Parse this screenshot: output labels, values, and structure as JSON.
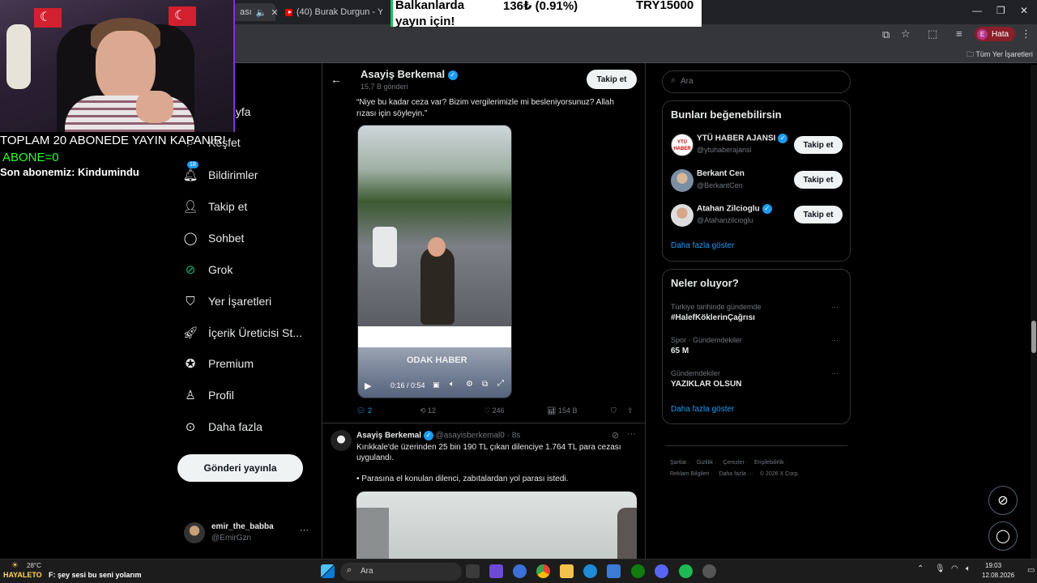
{
  "browser": {
    "tabs": [
      {
        "label": "ası",
        "active": true
      },
      {
        "label": "(40) Burak Durgun - YouTube",
        "active": false
      }
    ],
    "profile": {
      "initial": "E",
      "label": "Hata"
    },
    "bookmarks_folder": "Tüm Yer İşaretleri"
  },
  "ticker": {
    "line1": "Balkanlarda",
    "line2": "yayın için!",
    "change": "136₺ (0.91%)",
    "total": "TRY15000"
  },
  "stream_overlay": {
    "line1": "TOPLAM 20 ABONEDE YAYIN KAPANIR!",
    "line2": "ABONE=0",
    "line3": "Son abonemiz: Kindumindu"
  },
  "sidebar": {
    "items": [
      {
        "label": "ayfa",
        "icon": "home-icon"
      },
      {
        "label": "Keşfet",
        "icon": "search-icon"
      },
      {
        "label": "Bildirimler",
        "icon": "bell-icon",
        "badge": "18"
      },
      {
        "label": "Takip et",
        "icon": "add-user-icon"
      },
      {
        "label": "Sohbet",
        "icon": "chat-icon"
      },
      {
        "label": "Grok",
        "icon": "grok-icon"
      },
      {
        "label": "Yer İşaretleri",
        "icon": "bookmark-icon"
      },
      {
        "label": "İçerik Üreticisi St...",
        "icon": "rocket-icon"
      },
      {
        "label": "Premium",
        "icon": "verified-icon"
      },
      {
        "label": "Profil",
        "icon": "person-icon"
      },
      {
        "label": "Daha fazla",
        "icon": "more-circle-icon"
      }
    ],
    "post_button": "Gönderi yayınla",
    "account": {
      "name": "emir_the_babba",
      "handle": "@EmirGzn",
      "more": "···"
    }
  },
  "profile_header": {
    "name": "Asayiş Berkemal",
    "posts": "15,7 B gönderi",
    "follow": "Takip et"
  },
  "post1": {
    "text": "“Niye bu kadar ceza var? Bizim vergilerimizle mi besleniyorsunuz? Allah rızası için söyleyin.”",
    "video_time": "0:16 / 0:54",
    "watermark": "ODAK HABER",
    "actions": {
      "replies": "2",
      "reposts": "12",
      "likes": "246",
      "views": "154 B"
    }
  },
  "post2": {
    "name": "Asayiş Berkemal",
    "handle": "@asayisberkemal0",
    "time": "· 8s",
    "text1": "Kırıkkale'de üzerinden 25 bin 190 TL çıkan dilenciye 1.764 TL para cezası uygulandı.",
    "text2": "• Parasına el konulan dilenci, zabıtalardan yol parası istedi."
  },
  "search": {
    "placeholder": "Ara"
  },
  "who_to_follow": {
    "title": "Bunları beğenebilirsin",
    "users": [
      {
        "name": "YTÜ HABER AJANSI",
        "handle": "@ytuhaberajansi",
        "verified": true,
        "button": "Takip et"
      },
      {
        "name": "Berkant Cen",
        "handle": "@BerkantCen",
        "verified": false,
        "button": "Takip et"
      },
      {
        "name": "Atahan Zilcioglu",
        "handle": "@Atahanzilcioglu",
        "verified": true,
        "button": "Takip et"
      }
    ],
    "show_more": "Daha fazla göster"
  },
  "trends": {
    "title": "Neler oluyor?",
    "items": [
      {
        "context": "Türkiye tarihinde gündemde",
        "name": "#HalefKöklerinÇağrısı"
      },
      {
        "context": "Spor · Gündemdekiler",
        "name": "65 M"
      },
      {
        "context": "Gündemdekiler",
        "name": "YAZIKLAR OLSUN"
      }
    ],
    "show_more": "Daha fazla göster"
  },
  "footer": {
    "links": [
      "Şartlar",
      "Gizlilik",
      "Çerezler",
      "Erişilebilirlik",
      "Reklam Bilgileri",
      "Daha fazla ···",
      "© 2026 X Corp."
    ]
  },
  "taskbar": {
    "weather": "28°C",
    "stream_text": "HAYALETO",
    "now_playing": "F: şey sesi bu seni yolarım",
    "search": "Ara",
    "time": "19:03",
    "date": "12.08.2026"
  },
  "colors": {
    "accent": "#1d9bf0",
    "bg": "#000000",
    "border": "#2f3336",
    "muted": "#71767b"
  }
}
